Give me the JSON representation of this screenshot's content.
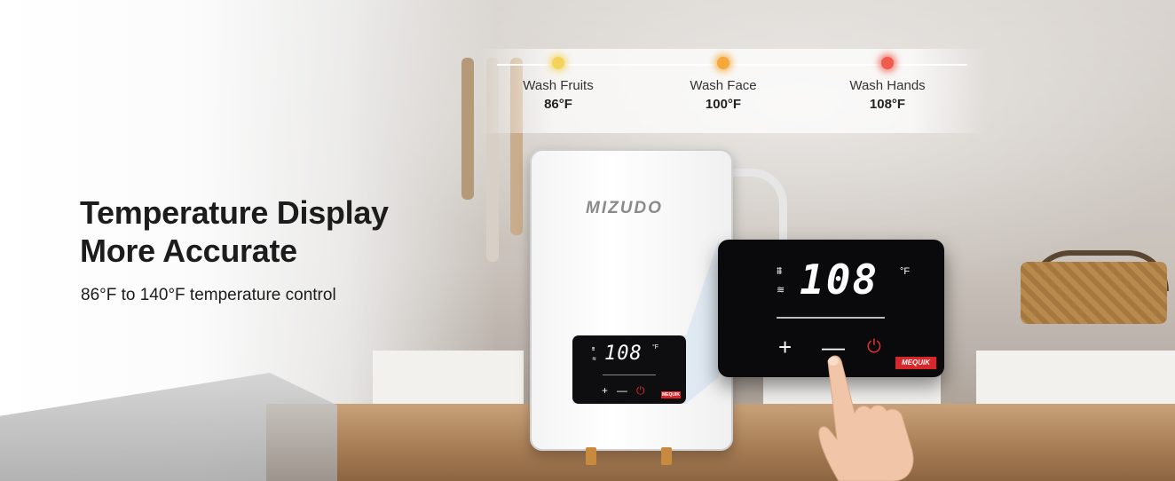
{
  "headline": {
    "line1": "Temperature Display",
    "line2": "More Accurate"
  },
  "subline": "86°F to 140°F temperature control",
  "modes": [
    {
      "label": "Wash Fruits",
      "value": "86°F",
      "color": "#f3d35a"
    },
    {
      "label": "Wash Face",
      "value": "100°F",
      "color": "#f5a93a"
    },
    {
      "label": "Wash Hands",
      "value": "108°F",
      "color": "#ef5b4c"
    }
  ],
  "heater": {
    "brand": "MIZUDO"
  },
  "display": {
    "digits": "108",
    "unit": "°F",
    "plus": "+",
    "minus": "—",
    "power": "⏻",
    "logo": "MEQUIK"
  },
  "colors": {
    "accent": "#d8262a"
  }
}
